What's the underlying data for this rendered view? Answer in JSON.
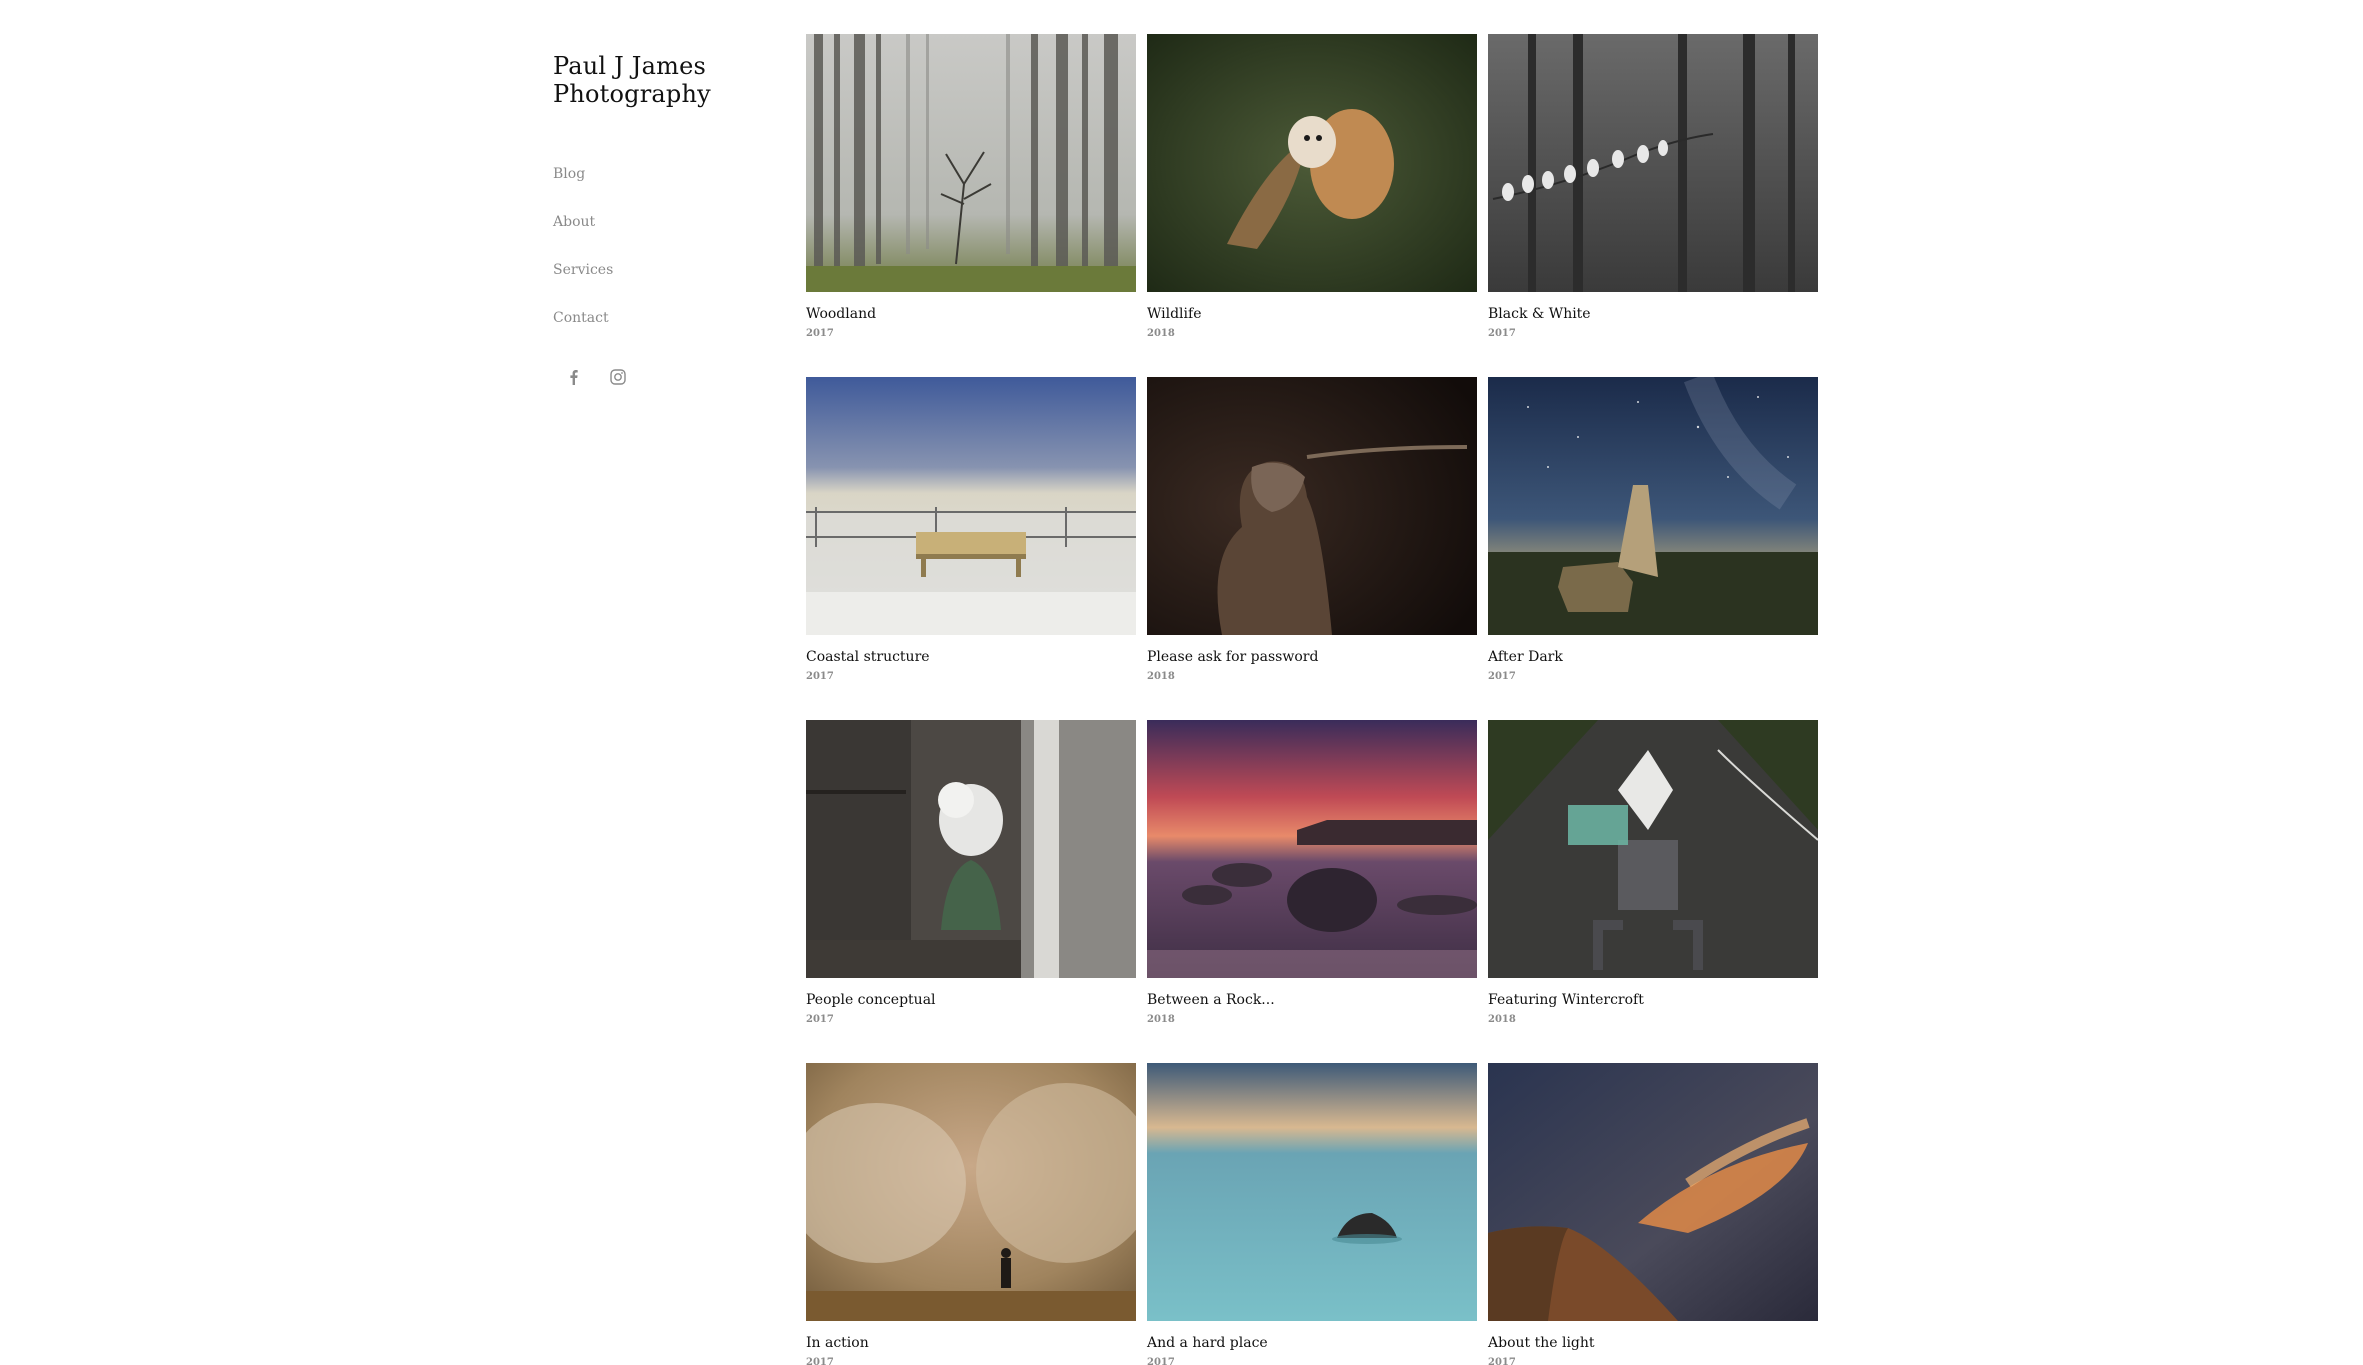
{
  "site": {
    "title_line1": "Paul J James",
    "title_line2": "Photography"
  },
  "nav": [
    {
      "label": "Blog"
    },
    {
      "label": "About"
    },
    {
      "label": "Services"
    },
    {
      "label": "Contact"
    }
  ],
  "social": [
    {
      "icon": "facebook-icon"
    },
    {
      "icon": "instagram-icon"
    }
  ],
  "gallery": [
    {
      "title": "Woodland",
      "year": "2017"
    },
    {
      "title": "Wildlife",
      "year": "2018"
    },
    {
      "title": "Black & White",
      "year": "2017"
    },
    {
      "title": "Coastal structure",
      "year": "2017"
    },
    {
      "title": "Please ask for password",
      "year": "2018"
    },
    {
      "title": "After Dark",
      "year": "2017"
    },
    {
      "title": "People conceptual",
      "year": "2017"
    },
    {
      "title": "Between a Rock...",
      "year": "2018"
    },
    {
      "title": "Featuring Wintercroft",
      "year": "2018"
    },
    {
      "title": "In action",
      "year": "2017"
    },
    {
      "title": "And a hard place",
      "year": "2017"
    },
    {
      "title": "About the light",
      "year": "2017"
    }
  ],
  "colors": {
    "text": "#111111",
    "muted": "#8a8a8a",
    "background": "#ffffff"
  }
}
